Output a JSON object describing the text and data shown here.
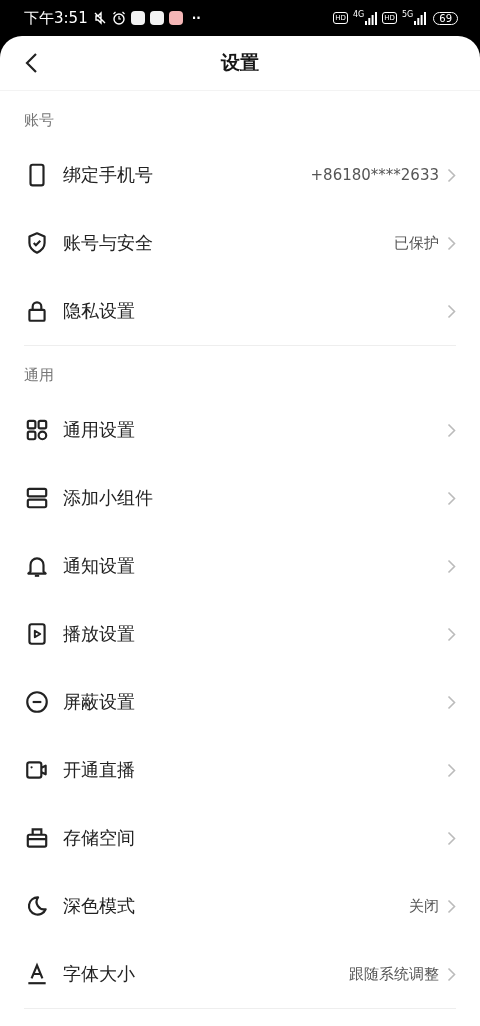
{
  "status_bar": {
    "time": "下午3:51",
    "more": "··",
    "sim1_badge": "HD",
    "sim1_network": "4G",
    "sim2_badge": "HD",
    "sim2_network": "5G",
    "battery": "69"
  },
  "header": {
    "title": "设置"
  },
  "sections": [
    {
      "title": "账号",
      "items": [
        {
          "label": "绑定手机号",
          "value": "+86180****2633"
        },
        {
          "label": "账号与安全",
          "value": "已保护"
        },
        {
          "label": "隐私设置"
        }
      ]
    },
    {
      "title": "通用",
      "items": [
        {
          "label": "通用设置"
        },
        {
          "label": "添加小组件"
        },
        {
          "label": "通知设置"
        },
        {
          "label": "播放设置"
        },
        {
          "label": "屏蔽设置"
        },
        {
          "label": "开通直播"
        },
        {
          "label": "存储空间"
        },
        {
          "label": "深色模式",
          "value": "关闭"
        },
        {
          "label": "字体大小",
          "value": "跟随系统调整"
        }
      ]
    }
  ]
}
